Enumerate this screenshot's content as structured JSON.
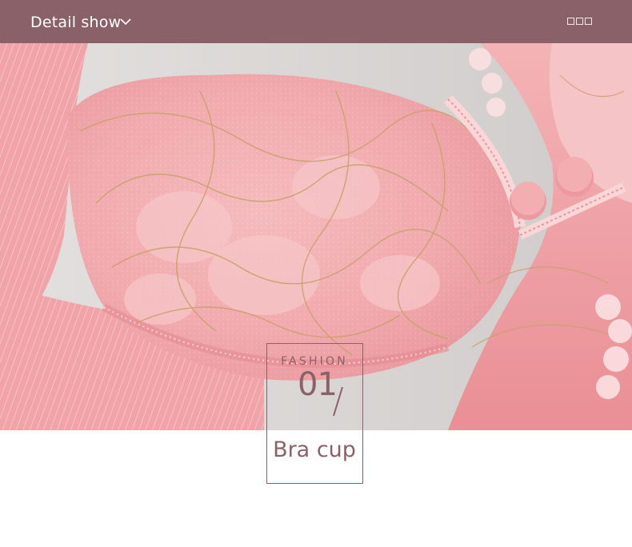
{
  "header": {
    "title": "Detail show",
    "chevron_icon": "chevron-down-icon",
    "glyph_icons": "three-square-glyphs-icon"
  },
  "photo": {
    "subject": "pink lace bra cup close-up"
  },
  "label": {
    "kicker": "FASHION",
    "number": "01",
    "caption": "Bra cup"
  },
  "colors": {
    "header_bg": "#8b6169",
    "accent": "#8b6169",
    "fabric_pink": "#f2a9ad"
  }
}
